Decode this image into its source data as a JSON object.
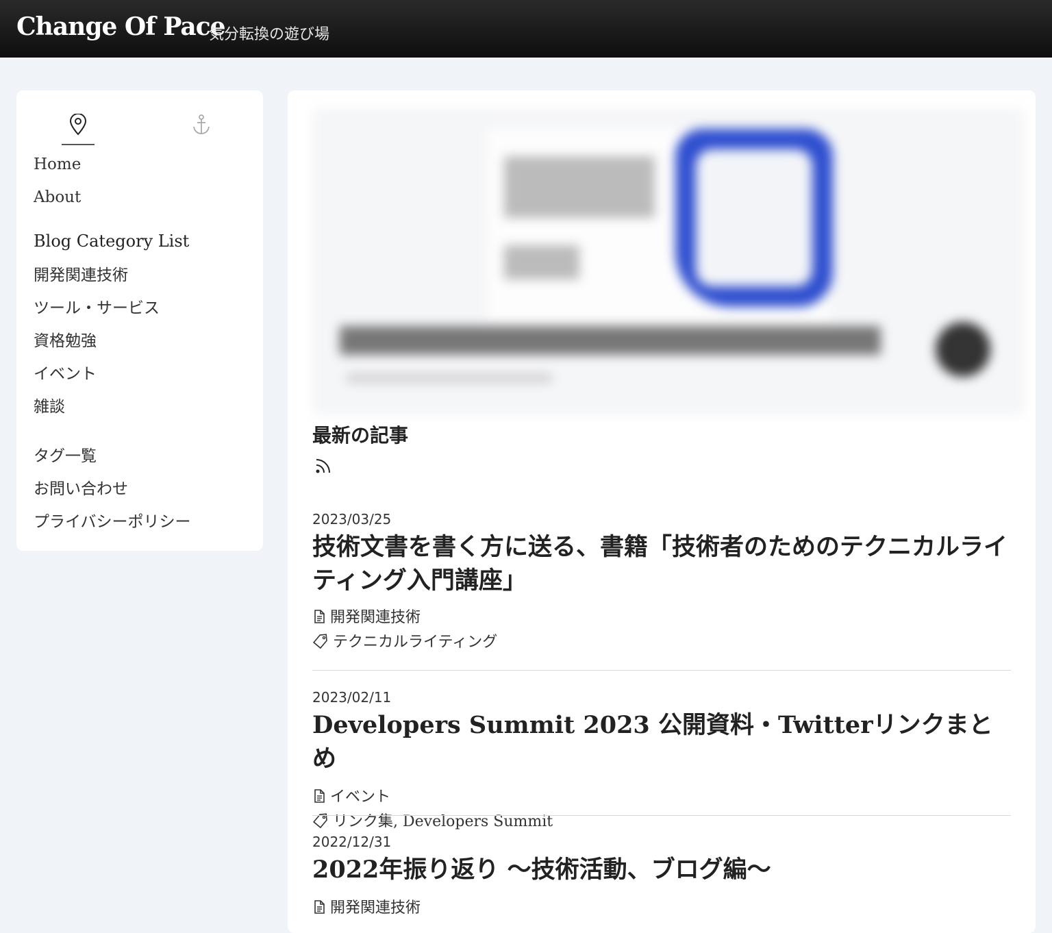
{
  "header": {
    "title": "Change Of Pace",
    "subtitle": "気分転換の遊び場"
  },
  "sidebar": {
    "tab_icons": [
      "map-pin-icon",
      "anchor-icon"
    ],
    "nav": [
      "Home",
      "About"
    ],
    "category_heading": "Blog Category List",
    "categories": [
      "開発関連技術",
      "ツール・サービス",
      "資格勉強",
      "イベント",
      "雑談"
    ],
    "links": [
      "タグ一覧",
      "お問い合わせ",
      "プライバシーポリシー"
    ]
  },
  "main": {
    "section_title": "最新の記事",
    "feed_icon": "rss-icon",
    "posts": [
      {
        "date": "2023/03/25",
        "title": "技術文書を書く方に送る、書籍「技術者のためのテクニカルライティング入門講座」",
        "category": "開発関連技術",
        "tags": "テクニカルライティング"
      },
      {
        "date": "2023/02/11",
        "title": "Developers Summit 2023 公開資料・Twitterリンクまとめ",
        "category": "イベント",
        "tags": "リンク集, Developers Summit"
      },
      {
        "date": "2022/12/31",
        "title": "2022年振り返り 〜技術活動、ブログ編〜",
        "category": "開発関連技術"
      }
    ]
  }
}
